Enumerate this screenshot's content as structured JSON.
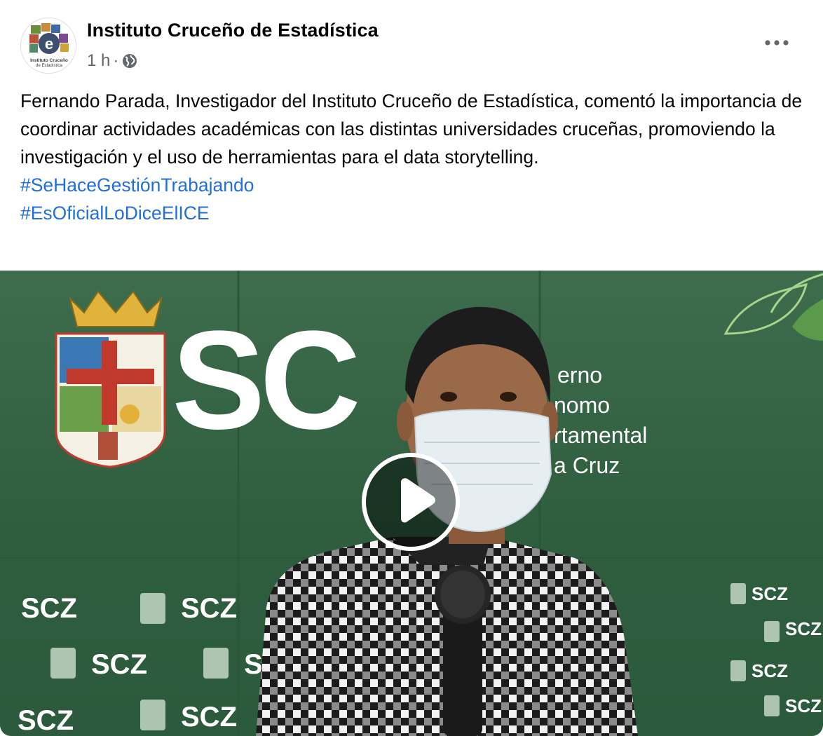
{
  "post": {
    "page_name": "Instituto Cruceño de Estadística",
    "avatar_caption_line1": "Instituto Cruceño",
    "avatar_caption_line2": "de Estadística",
    "avatar_letter": "e",
    "timestamp": "1 h",
    "separator": "·",
    "audience_icon": "globe-icon",
    "more_icon": "more-options-icon",
    "message": "Fernando Parada, Investigador del Instituto Cruceño de Estadística, comentó la importancia de coordinar actividades académicas con las distintas universidades cruceñas, promoviendo la investigación y el uso de herramientas para el data storytelling.",
    "hashtags": [
      "#SeHaceGestiónTrabajando",
      "#EsOficialLoDiceElICE"
    ]
  },
  "video": {
    "backdrop_logo": "SC",
    "backdrop_text_lines": [
      "erno",
      "nomo",
      "rtamental",
      "a Cruz"
    ],
    "backdrop_small_logo": "SCZ",
    "play_icon": "play-icon"
  },
  "colors": {
    "hashtag": "#216fdb",
    "meta": "#65676b",
    "backdrop_green": "#3f6e4d"
  }
}
